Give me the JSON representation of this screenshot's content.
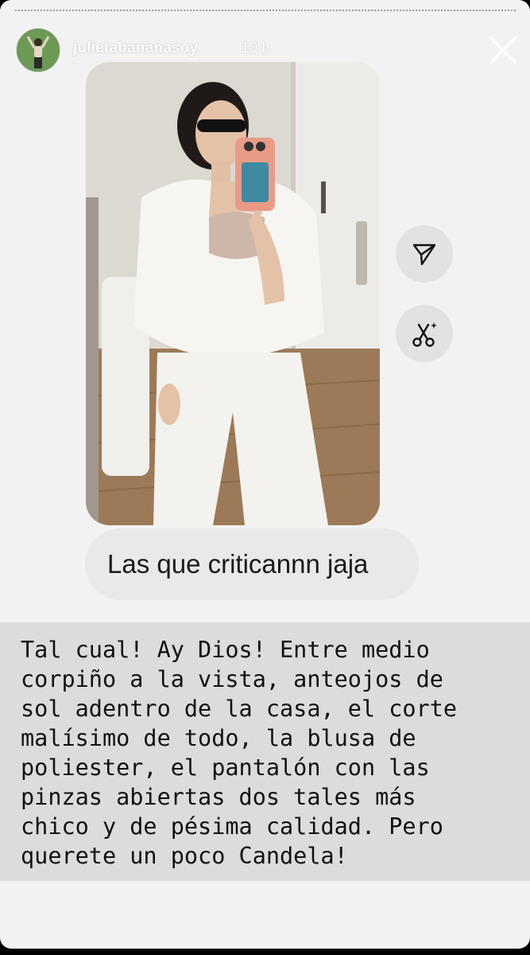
{
  "story": {
    "username": "julietabananasoy",
    "time_ago": "10 h",
    "caption": "Las que criticannn jaja",
    "text_overlay": "Tal cual! Ay Dios! Entre medio\ncorpiño a la vista, anteojos de\nsol adentro de la casa, el corte\nmalísimo de todo, la blusa de\npoliester, el pantalón con las\npinzas abiertas dos tales más\nchico y de pésima calidad. Pero\nquerete un poco Candela!"
  },
  "icons": {
    "close": "close-icon",
    "send": "send-icon",
    "cut": "scissors-sparkle-icon"
  },
  "colors": {
    "background": "#f2f2f2",
    "button_bg": "#e2e2e2",
    "text_box_bg": "#dcdcdc"
  }
}
